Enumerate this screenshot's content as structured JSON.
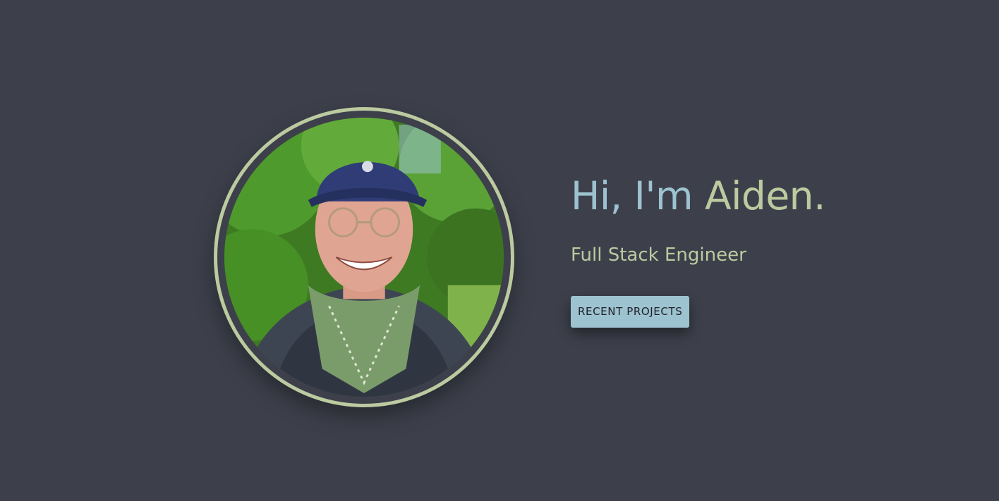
{
  "hero": {
    "greeting_hi": "Hi, I'm ",
    "greeting_name": "Aiden.",
    "role": "Full Stack Engineer",
    "cta_label": "RECENT PROJECTS"
  },
  "colors": {
    "background": "#3d404b",
    "accent_blue": "#9dc2d0",
    "accent_green": "#bccaa0"
  }
}
